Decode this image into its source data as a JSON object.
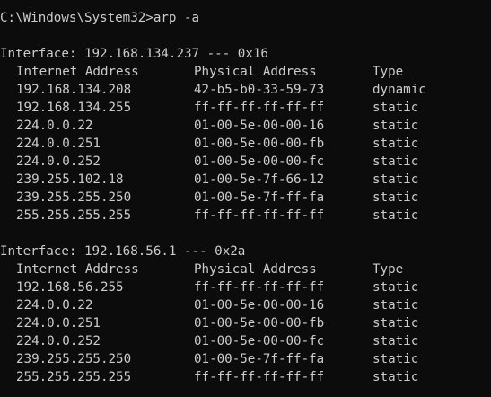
{
  "window": {
    "background": "#0c0c0c",
    "foreground": "#cccccc"
  },
  "prompt": "C:\\Windows\\System32>",
  "command": "arp -a",
  "interfaces": [
    {
      "header": "Interface: 192.168.134.237 --- 0x16",
      "columns": [
        "Internet Address",
        "Physical Address",
        "Type"
      ],
      "rows": [
        [
          "192.168.134.208",
          "42-b5-b0-33-59-73",
          "dynamic"
        ],
        [
          "192.168.134.255",
          "ff-ff-ff-ff-ff-ff",
          "static"
        ],
        [
          "224.0.0.22",
          "01-00-5e-00-00-16",
          "static"
        ],
        [
          "224.0.0.251",
          "01-00-5e-00-00-fb",
          "static"
        ],
        [
          "224.0.0.252",
          "01-00-5e-00-00-fc",
          "static"
        ],
        [
          "239.255.102.18",
          "01-00-5e-7f-66-12",
          "static"
        ],
        [
          "239.255.255.250",
          "01-00-5e-7f-ff-fa",
          "static"
        ],
        [
          "255.255.255.255",
          "ff-ff-ff-ff-ff-ff",
          "static"
        ]
      ]
    },
    {
      "header": "Interface: 192.168.56.1 --- 0x2a",
      "columns": [
        "Internet Address",
        "Physical Address",
        "Type"
      ],
      "rows": [
        [
          "192.168.56.255",
          "ff-ff-ff-ff-ff-ff",
          "static"
        ],
        [
          "224.0.0.22",
          "01-00-5e-00-00-16",
          "static"
        ],
        [
          "224.0.0.251",
          "01-00-5e-00-00-fb",
          "static"
        ],
        [
          "224.0.0.252",
          "01-00-5e-00-00-fc",
          "static"
        ],
        [
          "239.255.255.250",
          "01-00-5e-7f-ff-fa",
          "static"
        ],
        [
          "255.255.255.255",
          "ff-ff-ff-ff-ff-ff",
          "static"
        ]
      ]
    }
  ]
}
